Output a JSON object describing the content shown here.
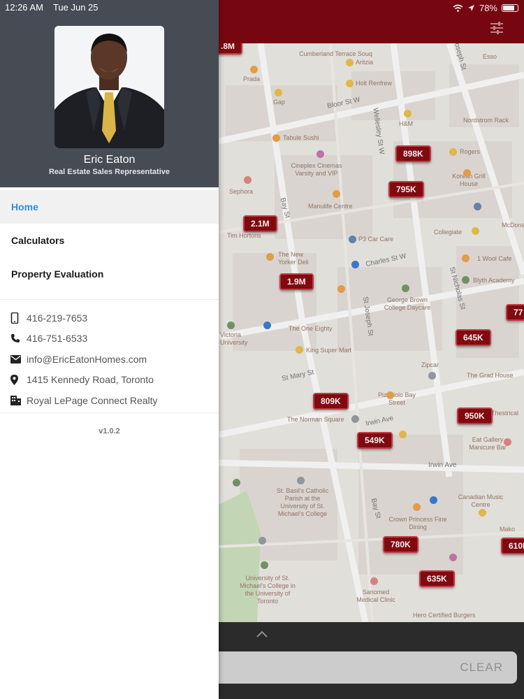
{
  "status_bar": {
    "time": "12:26 AM",
    "date": "Tue Jun 25",
    "battery": "78%",
    "battery_level": 0.78
  },
  "profile": {
    "name": "Eric Eaton",
    "title": "Real Estate Sales Representative"
  },
  "menu": [
    {
      "label": "Home",
      "active": true
    },
    {
      "label": "Calculators",
      "active": false
    },
    {
      "label": "Property Evaluation",
      "active": false
    }
  ],
  "contacts": {
    "mobile": "416-219-7653",
    "phone": "416-751-6533",
    "email": "info@EricEatonHomes.com",
    "address": "1415 Kennedy Road, Toronto",
    "brokerage": "Royal LePage Connect Realty"
  },
  "version": "v1.0.2",
  "map": {
    "price_markers": [
      "898K",
      "795K",
      "2.1M",
      "1.9M",
      "645K",
      "77",
      "809K",
      "950K",
      "549K",
      "780K",
      "610K",
      "635K",
      ".8M"
    ],
    "streets": [
      "Bloor St W",
      "Bay St",
      "Charles St W",
      "St Joseph St",
      "St Nicholas St",
      "Irwin Ave",
      "Bay St",
      "St Mary St",
      "Wellesley St W",
      "St Joseph St",
      "Irwin Ave"
    ],
    "places": [
      "Cumberland Terrace Souq",
      "Aritzia",
      "Holt Renfrew",
      "Prada",
      "Gap",
      "H&M",
      "Nordstrom Rack",
      "Tabule Sushi",
      "Cineplex Cinemas Varsity and VIP",
      "Sephora",
      "Rogers",
      "Korean Grill House",
      "Manulife Centre",
      "Collegiate",
      "Tim Hortons",
      "The New Yorker Deli",
      "P3 Car Care",
      "1 Wool Cafe",
      "Blyth Academy",
      "George Brown College Daycare",
      "The One Eighty",
      "King Super Mart",
      "The Grad House",
      "Zipcar",
      "Pizzaiolo Bay Street",
      "Thestrical",
      "Eat Gallery Manicure Bar",
      "The Norman Square",
      "St. Basil's Catholic Parish at the University of St. Michael's College",
      "Crown Princess Fine Dining",
      "Canadian Music Centre",
      "University of St. Michael's College in the University of Toronto",
      "Sanomed Medical Clinic",
      "Hero Certified Burgers",
      "Victoria University",
      "McDonald's",
      "Esso",
      "Mako"
    ]
  },
  "bottom_panel": {
    "clear_label": "CLEAR"
  },
  "colors": {
    "brand": "#7e0812",
    "link_active": "#2b8fd9",
    "drawer_header": "#464b54"
  },
  "icons": [
    "wifi-icon",
    "location-arrow-icon",
    "battery-icon",
    "filter-icon",
    "chevron-up-icon",
    "mobile-phone-icon",
    "phone-icon",
    "email-icon",
    "map-pin-icon",
    "building-icon"
  ]
}
